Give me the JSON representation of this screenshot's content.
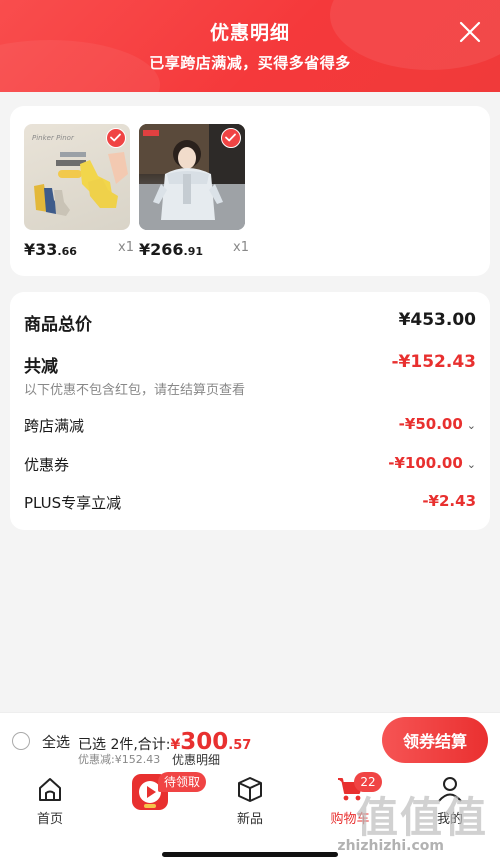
{
  "header": {
    "title": "优惠明细",
    "subtitle": "已享跨店满减，买得多省得多"
  },
  "products": [
    {
      "price_int": "¥33",
      "price_dec": ".66",
      "qty": "x1",
      "image": "socks-product-image"
    },
    {
      "price_int": "¥266",
      "price_dec": ".91",
      "qty": "x1",
      "image": "winter-coat-product-image"
    }
  ],
  "summary": {
    "total_label": "商品总价",
    "total_value": "¥453.00",
    "reduce_label": "共减",
    "reduce_value": "-¥152.43",
    "note": "以下优惠不包含红包，请在结算页查看",
    "items": [
      {
        "label": "跨店满减",
        "value": "-¥50.00",
        "expandable": true
      },
      {
        "label": "优惠券",
        "value": "-¥100.00",
        "expandable": true
      },
      {
        "label": "PLUS专享立减",
        "value": "-¥2.43",
        "expandable": false
      }
    ]
  },
  "checkout": {
    "select_all": "全选",
    "selected_text": "已选 2件,合计:",
    "total_yen": "¥",
    "total_int": "300",
    "total_dec": ".57",
    "discount_text": "优惠减:¥152.43",
    "detail_link": "优惠明细",
    "button": "领券结算"
  },
  "tabbar": {
    "tabs": [
      {
        "label": "首页",
        "icon": "home-icon"
      },
      {
        "label": "",
        "icon": "video-gift-icon",
        "badge": "待领取"
      },
      {
        "label": "新品",
        "icon": "box-icon"
      },
      {
        "label": "购物车",
        "icon": "cart-icon",
        "badge": "22",
        "active": true
      },
      {
        "label": "我的",
        "icon": "user-icon"
      }
    ]
  },
  "watermark": {
    "text": "值值值",
    "url": "zhizhizhi.com"
  },
  "colors": {
    "accent": "#e8302f",
    "header": "#f5393b",
    "background": "#f4f4f4"
  }
}
